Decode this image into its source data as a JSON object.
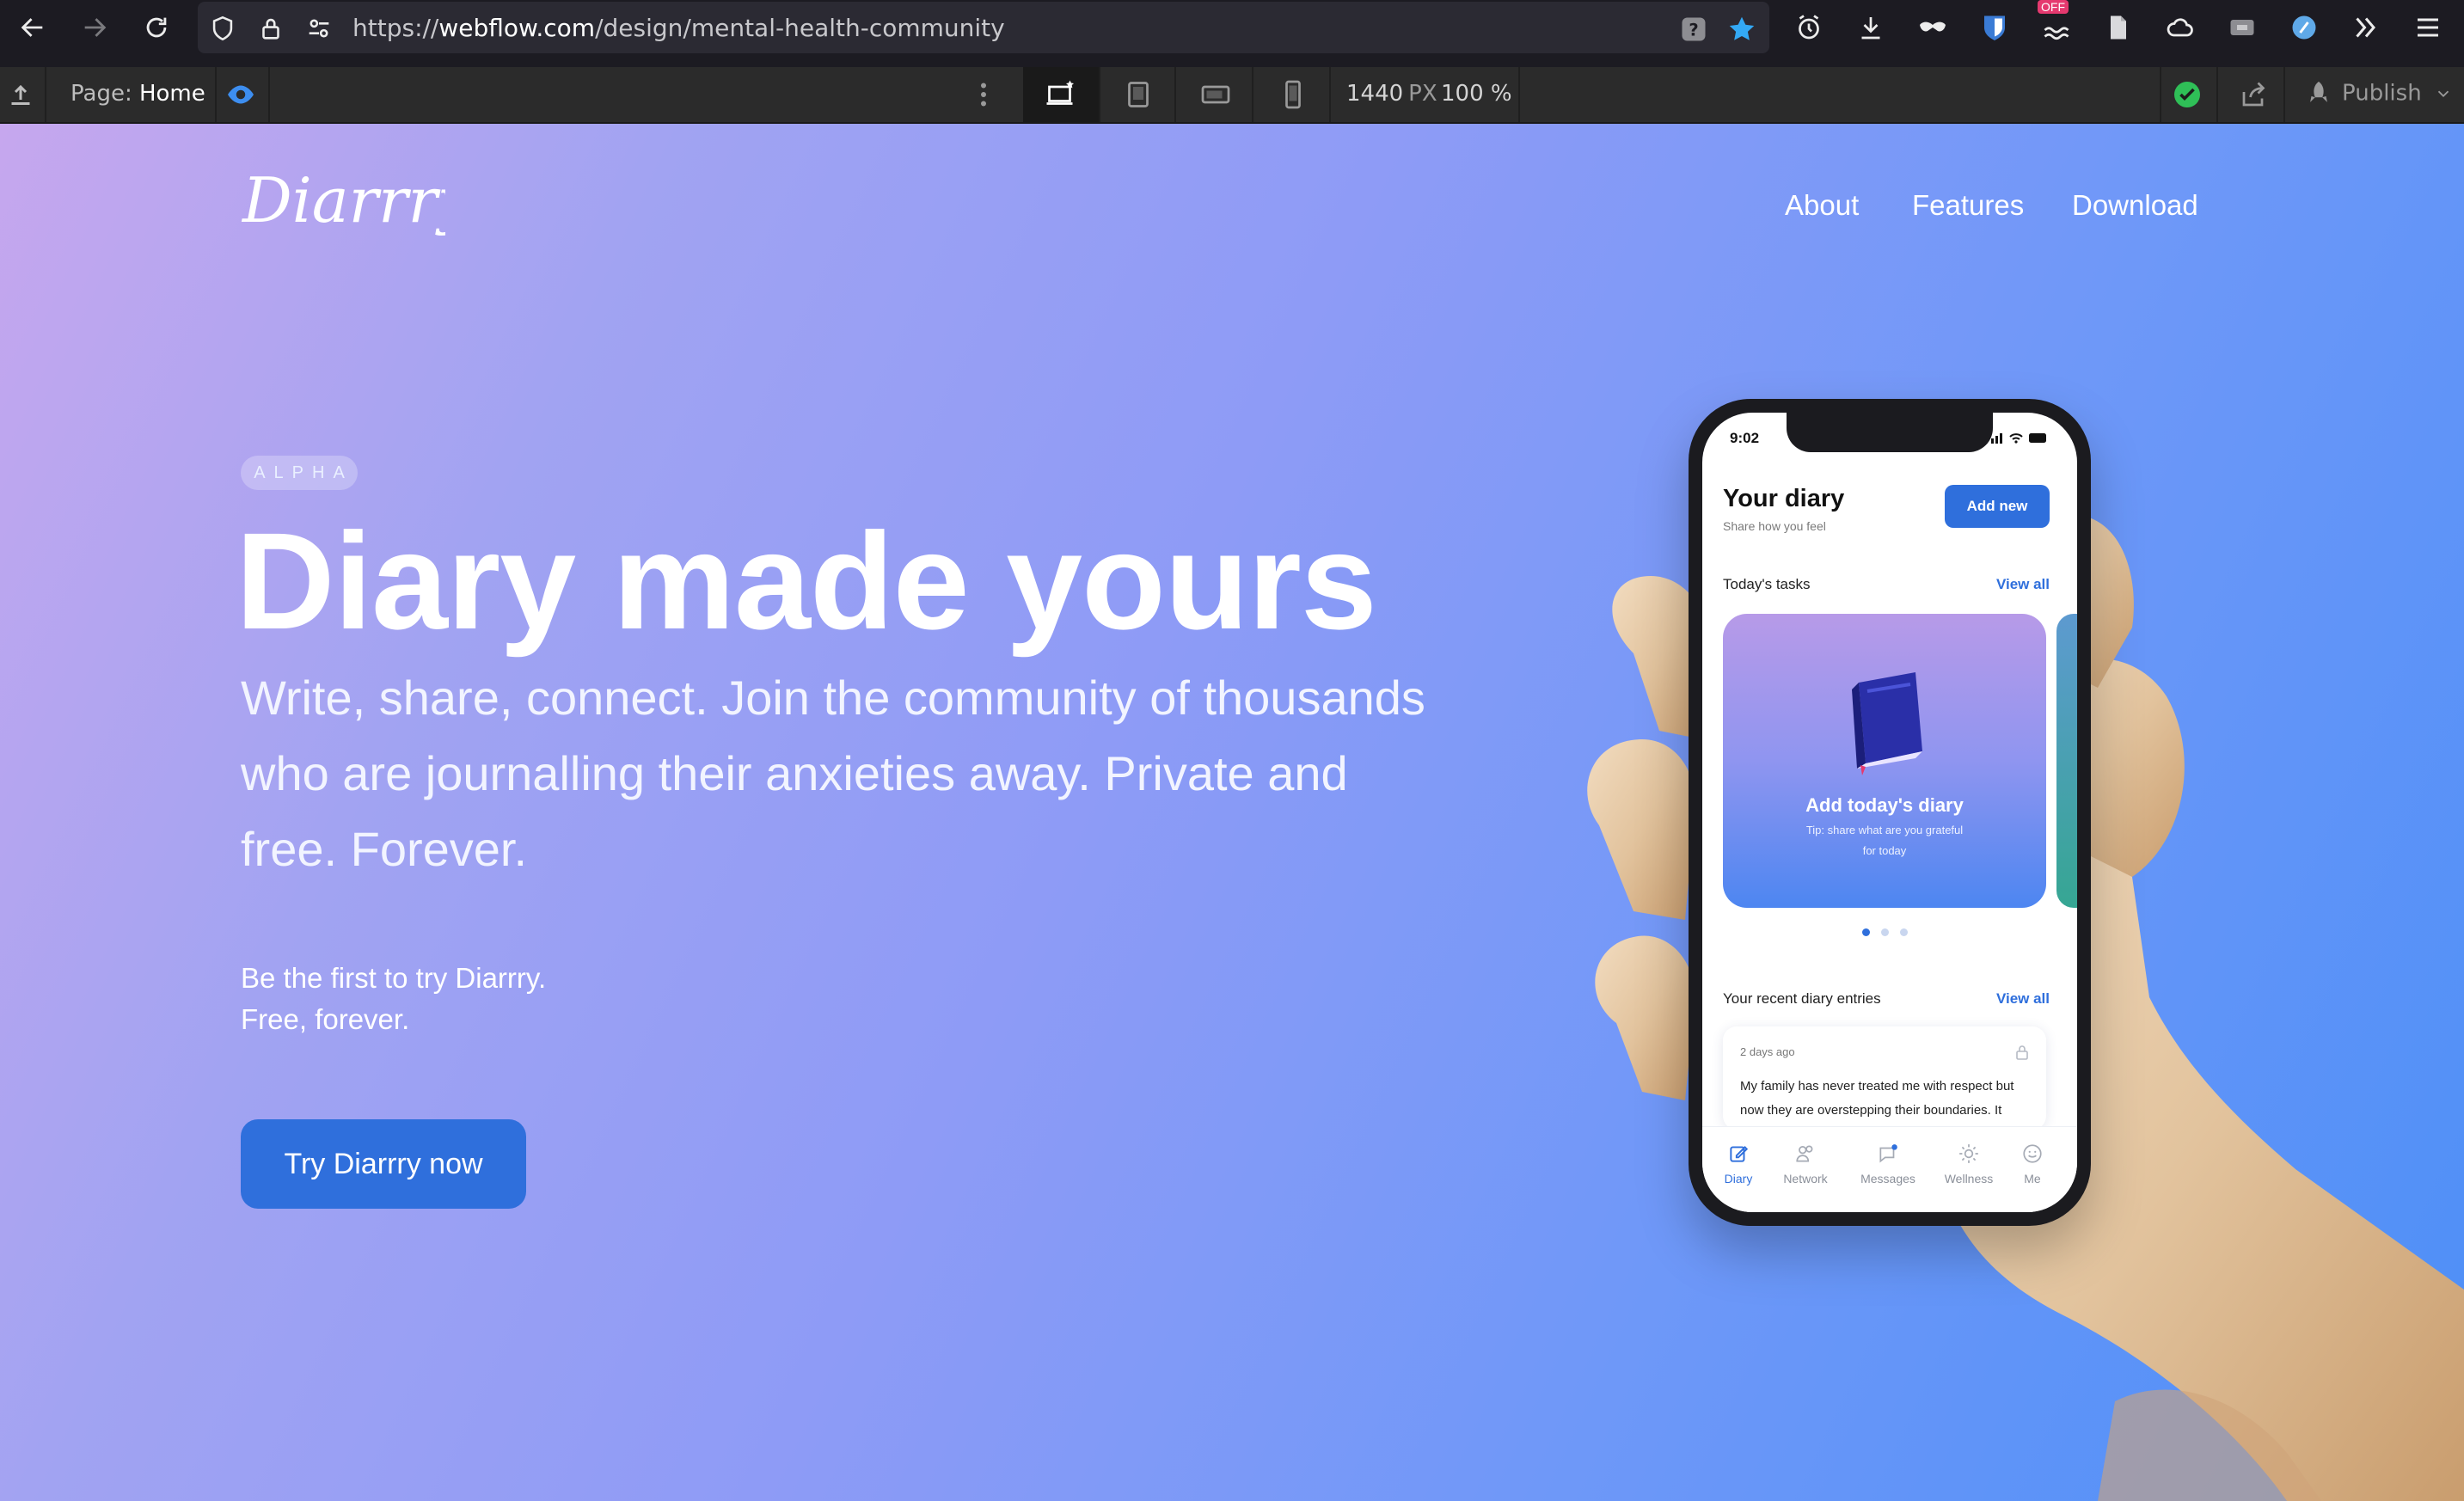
{
  "browser": {
    "url_prefix": "https://",
    "url_domain": "webflow.com",
    "url_path": "/design/mental-health-community",
    "ext_badge": "OFF"
  },
  "webflow": {
    "page_label": "Page:",
    "page_name": "Home",
    "width_value": "1440",
    "width_unit": "PX",
    "zoom": "100 %",
    "publish_label": "Publish"
  },
  "site": {
    "logo_text": "Diarrry",
    "nav": [
      "About",
      "Features",
      "Download"
    ],
    "badge": "ALPHA",
    "hero_title": "Diary made yours",
    "hero_subtitle": "Write, share, connect. Join the community of thousands who are journalling their anxieties away. Private and free. Forever.",
    "cta_line1": "Be the first to try Diarrry.",
    "cta_line2": "Free, forever.",
    "cta_button": "Try Diarrry now"
  },
  "app": {
    "status_time": "9:02",
    "title": "Your diary",
    "subtitle": "Share how you feel",
    "add_new": "Add new",
    "tasks_label": "Today's tasks",
    "view_all": "View all",
    "card_title": "Add today's diary",
    "card_tip": "Tip: share what are you grateful for today",
    "recent_label": "Your recent diary entries",
    "entry_date": "2 days ago",
    "entry_text": "My family has never treated me with respect but now they are overstepping their boundaries. It",
    "tabs": [
      "Diary",
      "Network",
      "Messages",
      "Wellness",
      "Me"
    ]
  },
  "colors": {
    "accent": "#2f6fdc",
    "status_ok": "#2fbf57",
    "extension_badge": "#e5396f"
  }
}
